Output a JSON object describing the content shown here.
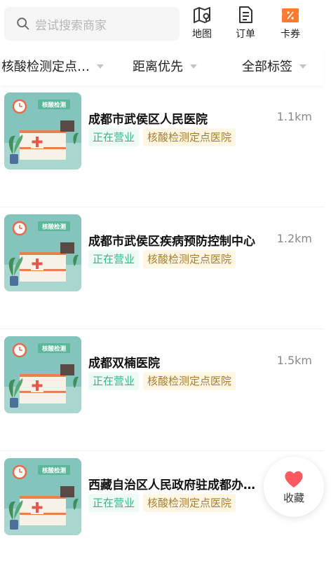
{
  "search": {
    "placeholder": "尝试搜索商家",
    "icon": "search-icon"
  },
  "header_buttons": [
    {
      "label": "地图",
      "icon": "map-icon"
    },
    {
      "label": "订单",
      "icon": "order-icon"
    },
    {
      "label": "卡券",
      "icon": "coupon-icon"
    }
  ],
  "filters": [
    {
      "label": "核酸检测定点…"
    },
    {
      "label": "距离优先"
    },
    {
      "label": "全部标签"
    }
  ],
  "items": [
    {
      "name": "成都市武侯区人民医院",
      "distance": "1.1km",
      "status": "正在营业",
      "category": "核酸检测定点医院",
      "thumb_label": "核酸检测"
    },
    {
      "name": "成都市武侯区疾病预防控制中心",
      "distance": "1.2km",
      "status": "正在营业",
      "category": "核酸检测定点医院",
      "thumb_label": "核酸检测"
    },
    {
      "name": "成都双楠医院",
      "distance": "1.5km",
      "status": "正在营业",
      "category": "核酸检测定点医院",
      "thumb_label": "核酸检测"
    },
    {
      "name": "西藏自治区人民政府驻成都办…",
      "distance": "",
      "status": "正在营业",
      "category": "核酸检测定点医院",
      "thumb_label": "核酸检测"
    }
  ],
  "favorite": {
    "label": "收藏",
    "icon": "heart-icon",
    "color": "#ff5a5f"
  },
  "colors": {
    "accent_orange": "#ff7a2e",
    "open_green": "#3bb38a",
    "tag_gold": "#a67e2e"
  }
}
